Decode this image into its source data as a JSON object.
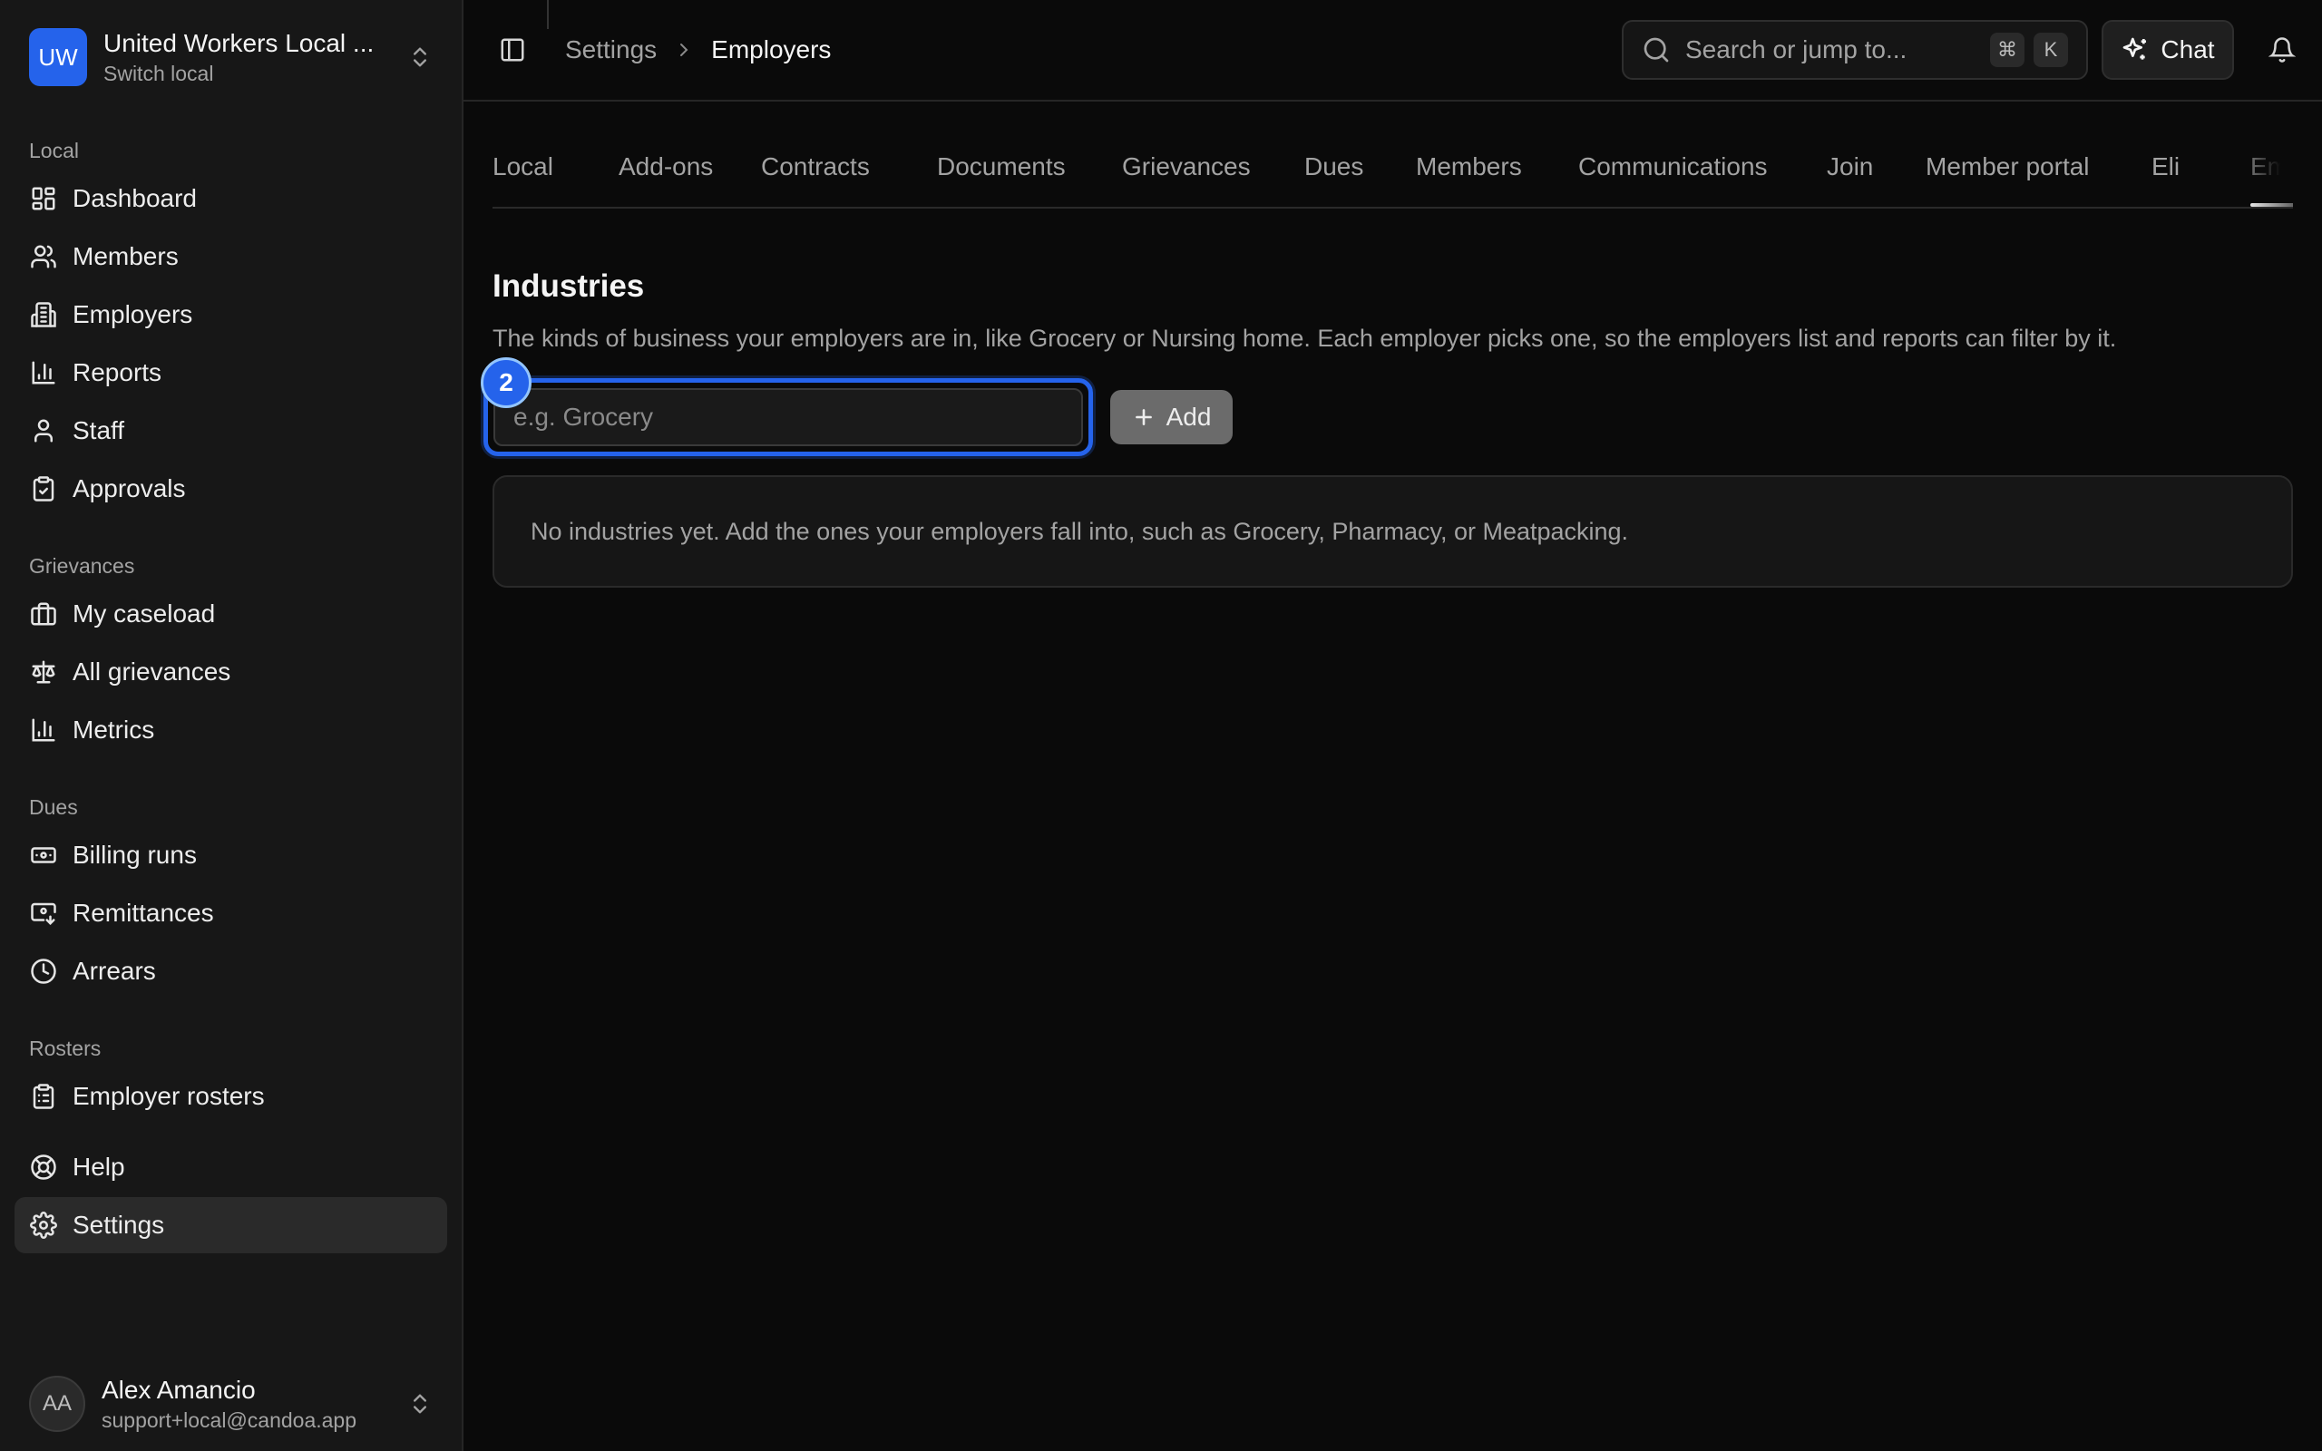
{
  "org": {
    "initials": "UW",
    "name": "United Workers Local ...",
    "switch_label": "Switch local"
  },
  "sidebar": {
    "groups": [
      {
        "label": "Local",
        "items": [
          {
            "label": "Dashboard",
            "icon": "dashboard-icon"
          },
          {
            "label": "Members",
            "icon": "users-icon"
          },
          {
            "label": "Employers",
            "icon": "building-icon"
          },
          {
            "label": "Reports",
            "icon": "bar-chart-icon"
          },
          {
            "label": "Staff",
            "icon": "user-icon"
          },
          {
            "label": "Approvals",
            "icon": "clipboard-check-icon"
          }
        ]
      },
      {
        "label": "Grievances",
        "items": [
          {
            "label": "My caseload",
            "icon": "briefcase-icon"
          },
          {
            "label": "All grievances",
            "icon": "scale-icon"
          },
          {
            "label": "Metrics",
            "icon": "bar-chart-icon"
          }
        ]
      },
      {
        "label": "Dues",
        "items": [
          {
            "label": "Billing runs",
            "icon": "banknote-icon"
          },
          {
            "label": "Remittances",
            "icon": "banknote-arrow-icon"
          },
          {
            "label": "Arrears",
            "icon": "clock-icon"
          }
        ]
      },
      {
        "label": "Rosters",
        "items": [
          {
            "label": "Employer rosters",
            "icon": "clipboard-list-icon"
          }
        ]
      }
    ],
    "footer_items": [
      {
        "label": "Help",
        "icon": "life-buoy-icon"
      },
      {
        "label": "Settings",
        "icon": "gear-icon",
        "active": true
      }
    ]
  },
  "user": {
    "initials": "AA",
    "name": "Alex Amancio",
    "email": "support+local@candoa.app"
  },
  "topbar": {
    "breadcrumb": {
      "parent": "Settings",
      "current": "Employers"
    },
    "search_placeholder": "Search or jump to...",
    "kbd_cmd": "⌘",
    "kbd_key": "K",
    "chat_label": "Chat"
  },
  "tabs": [
    {
      "label": "Local"
    },
    {
      "label": "Add-ons"
    },
    {
      "label": "Contracts"
    },
    {
      "label": "Documents"
    },
    {
      "label": "Grievances"
    },
    {
      "label": "Dues"
    },
    {
      "label": "Members"
    },
    {
      "label": "Communications"
    },
    {
      "label": "Join"
    },
    {
      "label": "Member portal"
    },
    {
      "label": "Eli"
    },
    {
      "label": "Emplo",
      "active": true
    }
  ],
  "industries": {
    "title": "Industries",
    "description": "The kinds of business your employers are in, like Grocery or Nursing home. Each employer picks one, so the employers list and reports can filter by it.",
    "input_placeholder": "e.g. Grocery",
    "input_value": "",
    "step_badge": "2",
    "add_label": "Add",
    "empty_text": "No industries yet. Add the ones your employers fall into, such as Grocery, Pharmacy, or Meatpacking."
  },
  "colors": {
    "accent": "#2563eb",
    "background": "#0a0a0a",
    "sidebar": "#171717"
  }
}
